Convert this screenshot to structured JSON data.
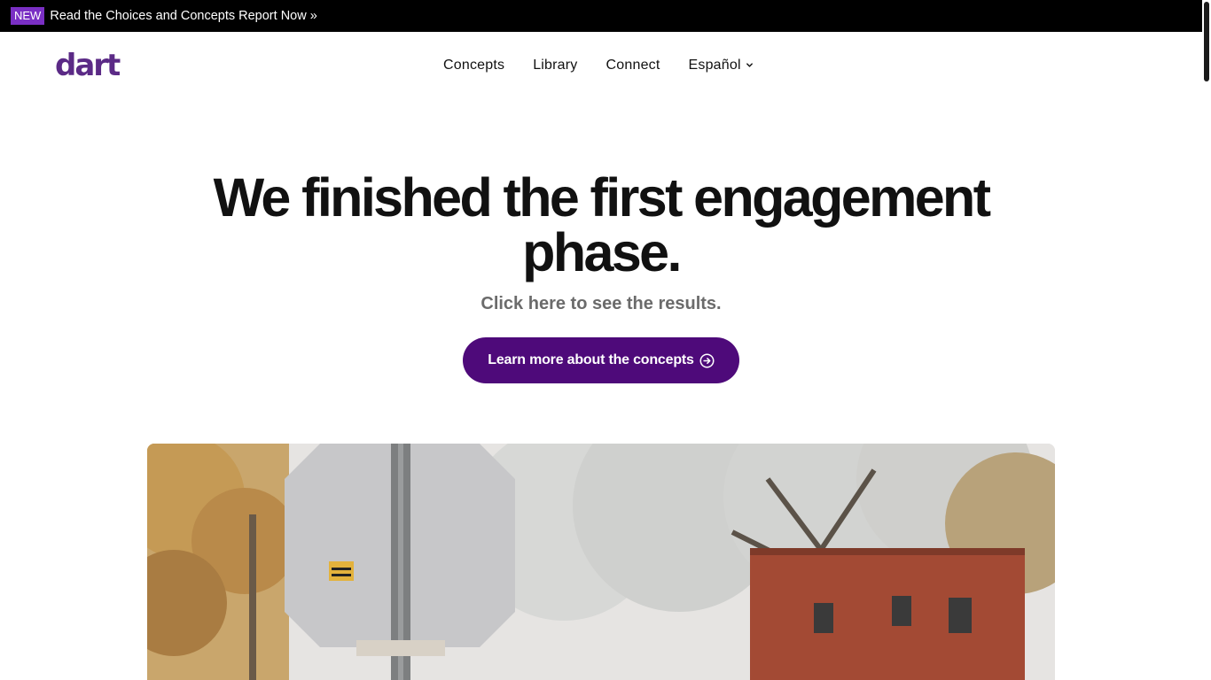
{
  "announcement": {
    "badge": "NEW",
    "link_text": "Read the Choices and Concepts Report Now »"
  },
  "header": {
    "logo": "dart",
    "nav": [
      {
        "label": "Concepts"
      },
      {
        "label": "Library"
      },
      {
        "label": "Connect"
      },
      {
        "label": "Español"
      }
    ]
  },
  "hero": {
    "title": "We finished the first engagement phase.",
    "subtitle": "Click here to see the results.",
    "cta_label": "Learn more about the concepts",
    "cta_icon": "circle-arrow-right-icon"
  },
  "image": {
    "description_icon": "street-photo"
  },
  "colors": {
    "brand": "#5b2a86",
    "cta_bg": "#4e0a7a",
    "badge_bg": "#7a2fc4",
    "announce_bg": "#000000"
  }
}
